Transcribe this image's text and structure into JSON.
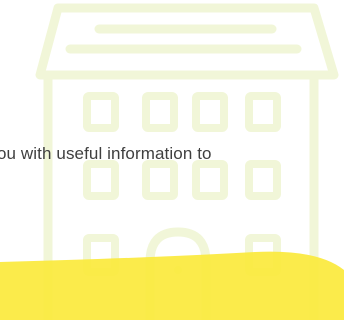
{
  "hero": {
    "info_text": "ou with useful information to",
    "icon_name": "building-icon"
  },
  "colors": {
    "building_stroke": "#f1f6d8",
    "highlight": "#fbe93c",
    "text": "#3f3f3f",
    "background": "#ffffff"
  }
}
